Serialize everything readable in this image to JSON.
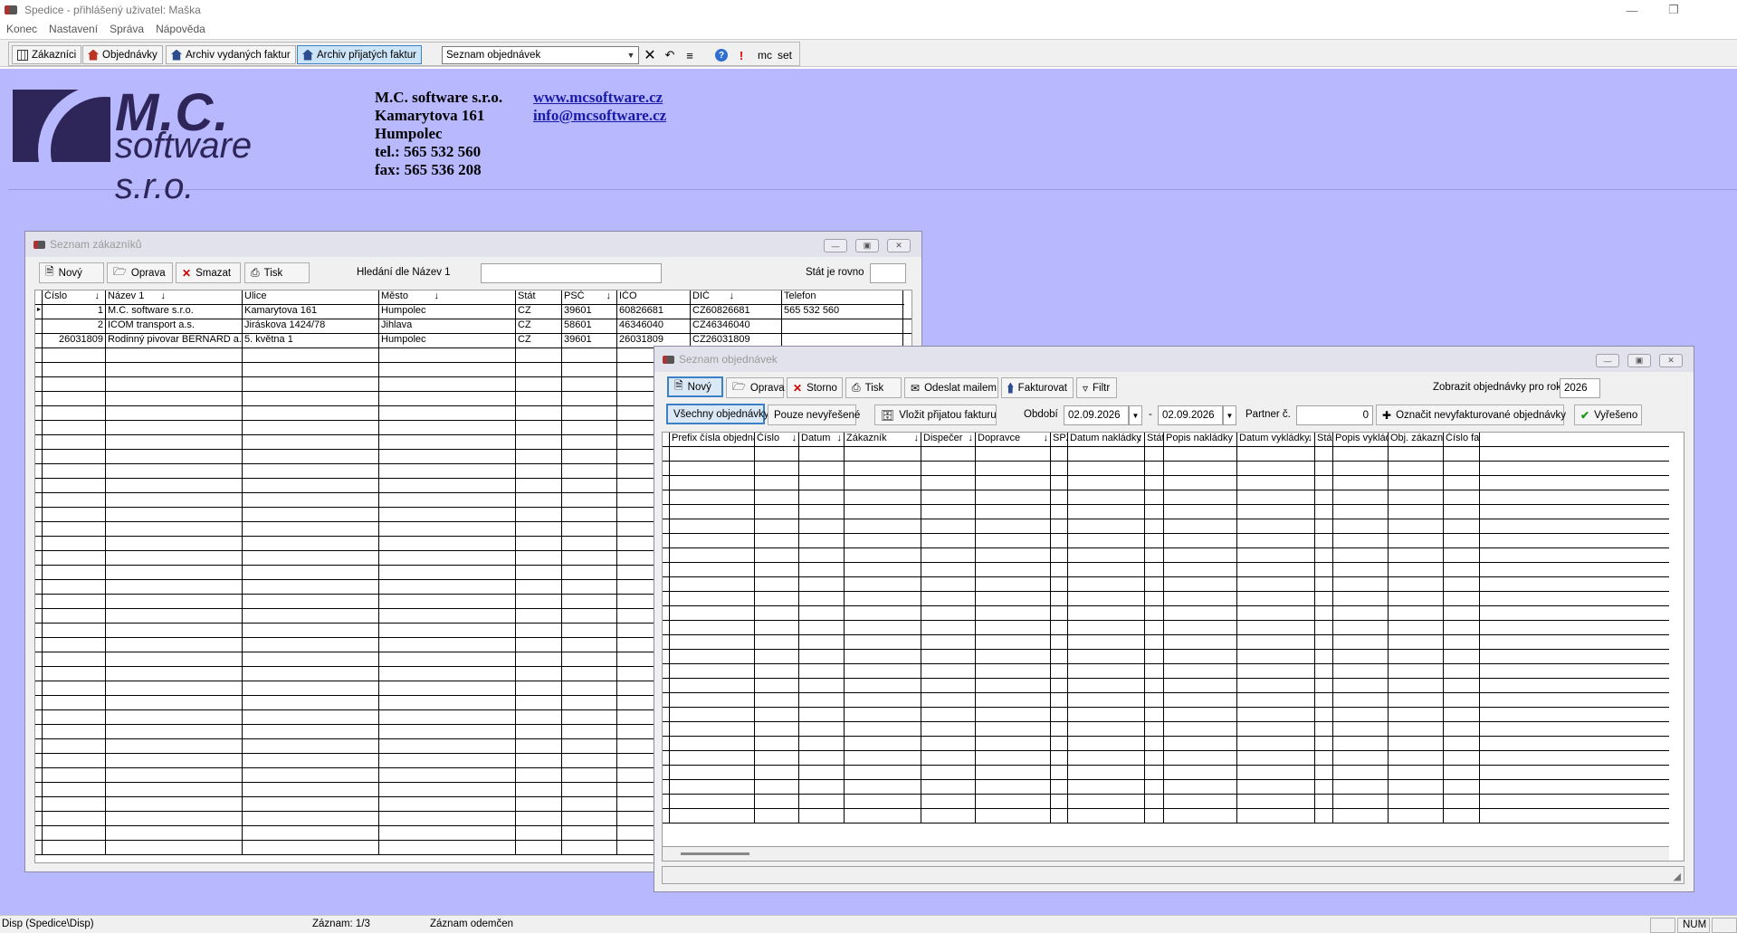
{
  "window": {
    "title": "Spedice - přihlášený uživatel: Maška"
  },
  "menu": [
    "Konec",
    "Nastavení",
    "Správa",
    "Nápověda"
  ],
  "toolbar": {
    "customers": "Zákazníci",
    "orders": "Objednávky",
    "issued_invoices": "Archiv vydaných faktur",
    "received_invoices": "Archiv přijatých faktur",
    "select_value": "Seznam objednávek",
    "mc": "mc",
    "set": "set"
  },
  "company": {
    "logo_mc": "M.C.",
    "logo_software": "software s.r.o.",
    "name": "M.C. software s.r.o.",
    "street": "Kamarytova 161",
    "city": "Humpolec",
    "tel": "tel.: 565 532 560",
    "fax": "fax: 565 536 208",
    "web": "www.mcsoftware.cz",
    "email": "info@mcsoftware.cz"
  },
  "customers_window": {
    "title": "Seznam zákazníků",
    "btn_new": "Nový",
    "btn_edit": "Oprava",
    "btn_delete": "Smazat",
    "btn_print": "Tisk",
    "search_label": "Hledání dle Název 1",
    "search_value": "",
    "state_label": "Stát je rovno",
    "state_value": "",
    "columns": [
      "Číslo",
      "Název 1",
      "Ulice",
      "Město",
      "Stát",
      "PSČ",
      "IČO",
      "DIČ",
      "Telefon"
    ],
    "rows": [
      [
        "1",
        "M.C. software s.r.o.",
        "Kamarytova 161",
        "Humpolec",
        "CZ",
        "39601",
        "60826681",
        "CZ60826681",
        "565 532 560"
      ],
      [
        "2",
        "ICOM transport a.s.",
        "Jiráskova 1424/78",
        "Jihlava",
        "CZ",
        "58601",
        "46346040",
        "CZ46346040",
        ""
      ],
      [
        "26031809",
        "Rodinný pivovar BERNARD a.s.",
        "5. května 1",
        "Humpolec",
        "CZ",
        "39601",
        "26031809",
        "CZ26031809",
        ""
      ]
    ]
  },
  "orders_window": {
    "title": "Seznam objednávek",
    "btn_new": "Nový",
    "btn_edit": "Oprava",
    "btn_storno": "Storno",
    "btn_print": "Tisk",
    "btn_mail": "Odeslat mailem",
    "btn_invoice": "Fakturovat",
    "btn_filter": "Filtr",
    "year_label": "Zobrazit objednávky pro rok",
    "year_value": "2026",
    "btn_all": "Všechny objednávky",
    "btn_unresolved": "Pouze nevyřešené",
    "btn_insert_invoice": "Vložit přijatou fakturu",
    "period_label": "Období",
    "date_from": "02.09.2026",
    "date_sep": "-",
    "date_to": "02.09.2026",
    "partner_label": "Partner č.",
    "partner_value": "0",
    "btn_mark": "Označit nevyfakturované objednávky",
    "btn_resolved": "Vyřešeno",
    "columns": [
      "Prefix čísla objednávky",
      "Číslo",
      "Datum",
      "Zákazník",
      "Dispečer",
      "Dopravce",
      "SPZ",
      "Datum nakládky",
      "Stát",
      "Popis nakládky",
      "Datum vykládky",
      "Stát",
      "Popis vykládky",
      "Obj. zákazníka",
      "Číslo faktur"
    ]
  },
  "statusbar": {
    "disp": "Disp (Spedice\\Disp)",
    "record": "Záznam: 1/3",
    "record_state": "Záznam odemčen",
    "num": "NUM"
  }
}
